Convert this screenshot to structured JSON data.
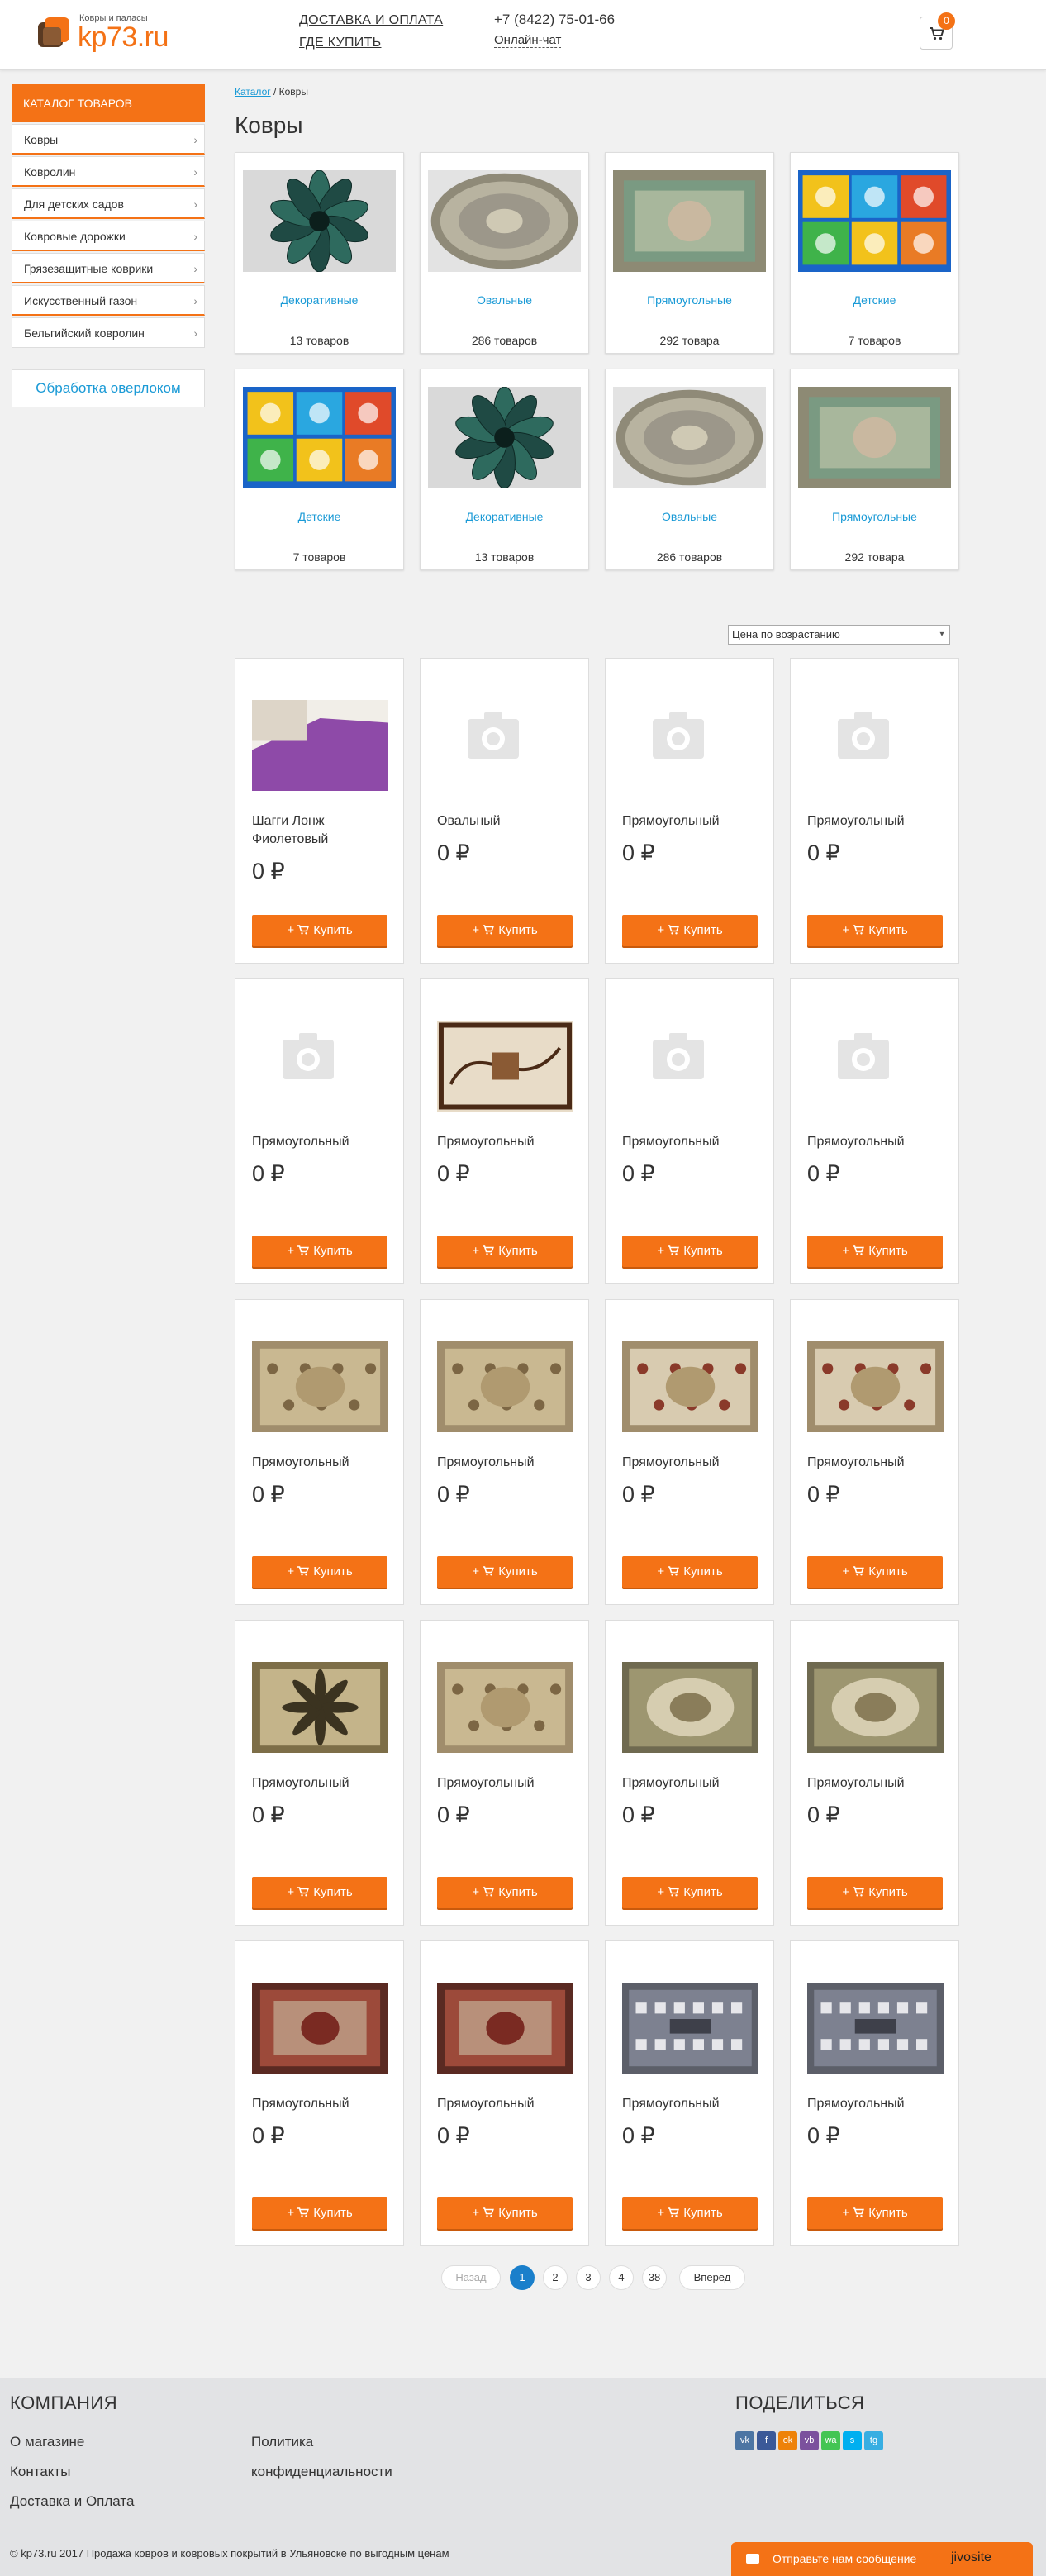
{
  "header": {
    "logo_tagline": "Ковры и паласы",
    "logo_text": "kp73.ru",
    "link_delivery": "ДОСТАВКА И ОПЛАТА",
    "link_where": "ГДЕ КУПИТЬ",
    "phone": "+7 (8422) 75-01-66",
    "chat": "Онлайн-чат",
    "cart_count": "0",
    "cart_icon": "cart-icon"
  },
  "sidebar": {
    "title": "КАТАЛОГ ТОВАРОВ",
    "items": [
      {
        "label": "Ковры"
      },
      {
        "label": "Ковролин"
      },
      {
        "label": "Для детских садов"
      },
      {
        "label": "Ковровые дорожки"
      },
      {
        "label": "Грязезащитные коврики"
      },
      {
        "label": "Искусственный газон"
      },
      {
        "label": "Бельгийский ковролин"
      }
    ],
    "overlock": "Обработка оверлоком"
  },
  "breadcrumb": {
    "link": "Каталог",
    "sep": " / ",
    "current": "Ковры"
  },
  "page_title": "Ковры",
  "subcategories": [
    {
      "name": "Декоративные",
      "count": "13 товаров",
      "pattern": "flower"
    },
    {
      "name": "Овальные",
      "count": "286 товаров",
      "pattern": "oval"
    },
    {
      "name": "Прямоугольные",
      "count": "292 товара",
      "pattern": "rect-green"
    },
    {
      "name": "Детские",
      "count": "7 товаров",
      "pattern": "kids"
    },
    {
      "name": "Детские",
      "count": "7 товаров",
      "pattern": "kids"
    },
    {
      "name": "Декоративные",
      "count": "13 товаров",
      "pattern": "flower"
    },
    {
      "name": "Овальные",
      "count": "286 товаров",
      "pattern": "oval"
    },
    {
      "name": "Прямоугольные",
      "count": "292 товара",
      "pattern": "rect-green"
    }
  ],
  "sort": {
    "selected": "Цена по возрастанию"
  },
  "buy_label": "Купить",
  "products": [
    {
      "name": "Шагги Лонж Фиолетовый",
      "price": "0 ₽",
      "image": "shaggy"
    },
    {
      "name": "Овальный",
      "price": "0 ₽",
      "image": "none"
    },
    {
      "name": "Прямоугольный",
      "price": "0 ₽",
      "image": "none"
    },
    {
      "name": "Прямоугольный",
      "price": "0 ₽",
      "image": "none"
    },
    {
      "name": "Прямоугольный",
      "price": "0 ₽",
      "image": "none"
    },
    {
      "name": "Прямоугольный",
      "price": "0 ₽",
      "image": "brown-swirl"
    },
    {
      "name": "Прямоугольный",
      "price": "0 ₽",
      "image": "none"
    },
    {
      "name": "Прямоугольный",
      "price": "0 ₽",
      "image": "none"
    },
    {
      "name": "Прямоугольный",
      "price": "0 ₽",
      "image": "beige-floral"
    },
    {
      "name": "Прямоугольный",
      "price": "0 ₽",
      "image": "beige-floral"
    },
    {
      "name": "Прямоугольный",
      "price": "0 ₽",
      "image": "cream-roses"
    },
    {
      "name": "Прямоугольный",
      "price": "0 ₽",
      "image": "cream-roses"
    },
    {
      "name": "Прямоугольный",
      "price": "0 ₽",
      "image": "leaf-olive"
    },
    {
      "name": "Прямоугольный",
      "price": "0 ₽",
      "image": "beige-medallion"
    },
    {
      "name": "Прямоугольный",
      "price": "0 ₽",
      "image": "olive-oval"
    },
    {
      "name": "Прямоугольный",
      "price": "0 ₽",
      "image": "olive-oval"
    },
    {
      "name": "Прямоугольный",
      "price": "0 ₽",
      "image": "red-persian"
    },
    {
      "name": "Прямоугольный",
      "price": "0 ₽",
      "image": "red-persian"
    },
    {
      "name": "Прямоугольный",
      "price": "0 ₽",
      "image": "grey-geo"
    },
    {
      "name": "Прямоугольный",
      "price": "0 ₽",
      "image": "grey-geo"
    }
  ],
  "pagination": {
    "prev": "Назад",
    "pages": [
      "1",
      "2",
      "3",
      "4",
      "38"
    ],
    "current": "1",
    "next": "Вперед"
  },
  "footer": {
    "company_title": "КОМПАНИЯ",
    "links_col1": [
      "О магазине",
      "Контакты",
      "Доставка и Оплата"
    ],
    "links_col2": [
      "Политика",
      "конфиденциальности"
    ],
    "share_title": "ПОДЕЛИТЬСЯ",
    "share_icons": [
      {
        "label": "vk",
        "color": "#4c75a3"
      },
      {
        "label": "f",
        "color": "#3b5998"
      },
      {
        "label": "ok",
        "color": "#ee8208"
      },
      {
        "label": "vb",
        "color": "#7b519d"
      },
      {
        "label": "wa",
        "color": "#43c553"
      },
      {
        "label": "s",
        "color": "#00aff0"
      },
      {
        "label": "tg",
        "color": "#37aee2"
      }
    ],
    "copyright": "© kp73.ru 2017 Продажа ковров и ковровых покрытий в Ульяновске по выгодным ценам"
  },
  "jivo": {
    "message": "Отправьте нам сообщение",
    "brand": "jivosite"
  },
  "colors": {
    "accent": "#f47216",
    "link": "#1a9ad6",
    "page_active": "#1a7fcb"
  }
}
